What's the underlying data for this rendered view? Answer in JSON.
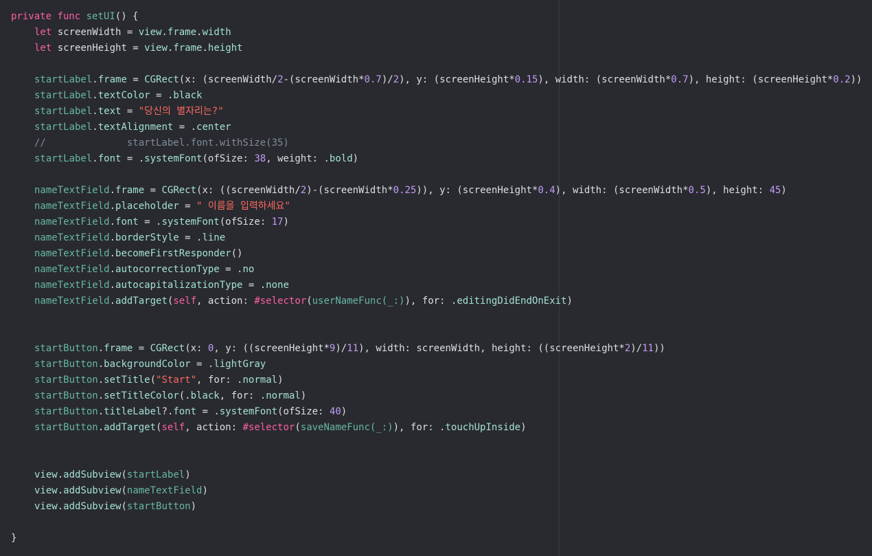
{
  "editor": {
    "theme": {
      "background": "#292a30",
      "guide": "#3a3b41",
      "keyword": "#fc5fa3",
      "project_symbol": "#67b7a4",
      "system_symbol": "#a3e1d4",
      "string": "#fc6a5d",
      "number": "#c29df5",
      "comment": "#7f8c98",
      "plain": "#dfdfe0"
    },
    "lines": [
      [
        {
          "t": "private",
          "c": "kw"
        },
        {
          "t": " "
        },
        {
          "t": "func",
          "c": "kw"
        },
        {
          "t": " "
        },
        {
          "t": "setUI",
          "c": "fn"
        },
        {
          "t": "() {"
        }
      ],
      [
        {
          "t": "",
          "i": 1
        },
        {
          "t": "let",
          "c": "kw"
        },
        {
          "t": " screenWidth = "
        },
        {
          "t": "view",
          "c": "sys"
        },
        {
          "t": "."
        },
        {
          "t": "frame",
          "c": "sys"
        },
        {
          "t": "."
        },
        {
          "t": "width",
          "c": "sys"
        }
      ],
      [
        {
          "t": "",
          "i": 1
        },
        {
          "t": "let",
          "c": "kw"
        },
        {
          "t": " screenHeight = "
        },
        {
          "t": "view",
          "c": "sys"
        },
        {
          "t": "."
        },
        {
          "t": "frame",
          "c": "sys"
        },
        {
          "t": "."
        },
        {
          "t": "height",
          "c": "sys"
        }
      ],
      [],
      [
        {
          "t": "",
          "i": 1
        },
        {
          "t": "startLabel",
          "c": "prj"
        },
        {
          "t": "."
        },
        {
          "t": "frame",
          "c": "sys"
        },
        {
          "t": " = "
        },
        {
          "t": "CGRect",
          "c": "sys"
        },
        {
          "t": "(x: (screenWidth/"
        },
        {
          "t": "2",
          "c": "nump"
        },
        {
          "t": "-(screenWidth*"
        },
        {
          "t": "0.7",
          "c": "nump"
        },
        {
          "t": ")/"
        },
        {
          "t": "2",
          "c": "nump"
        },
        {
          "t": "), y: (screenHeight*"
        },
        {
          "t": "0.15",
          "c": "nump"
        },
        {
          "t": "), width: (screenWidth*"
        },
        {
          "t": "0.7",
          "c": "nump"
        },
        {
          "t": "), height: (screenHeight*"
        },
        {
          "t": "0.2",
          "c": "nump"
        },
        {
          "t": "))"
        }
      ],
      [
        {
          "t": "",
          "i": 1
        },
        {
          "t": "startLabel",
          "c": "prj"
        },
        {
          "t": "."
        },
        {
          "t": "textColor",
          "c": "sys"
        },
        {
          "t": " = ."
        },
        {
          "t": "black",
          "c": "sys"
        }
      ],
      [
        {
          "t": "",
          "i": 1
        },
        {
          "t": "startLabel",
          "c": "prj"
        },
        {
          "t": "."
        },
        {
          "t": "text",
          "c": "sys"
        },
        {
          "t": " = "
        },
        {
          "t": "\"당신의 별자리는?\"",
          "c": "str"
        }
      ],
      [
        {
          "t": "",
          "i": 1
        },
        {
          "t": "startLabel",
          "c": "prj"
        },
        {
          "t": "."
        },
        {
          "t": "textAlignment",
          "c": "sys"
        },
        {
          "t": " = ."
        },
        {
          "t": "center",
          "c": "sys"
        }
      ],
      [
        {
          "t": "",
          "i": 1
        },
        {
          "t": "//",
          "c": "cmt"
        },
        {
          "t": "",
          "i": 2
        },
        {
          "t": "startLabel.font.withSize(35)",
          "c": "cmt"
        }
      ],
      [
        {
          "t": "",
          "i": 1
        },
        {
          "t": "startLabel",
          "c": "prj"
        },
        {
          "t": "."
        },
        {
          "t": "font",
          "c": "sys"
        },
        {
          "t": " = ."
        },
        {
          "t": "systemFont",
          "c": "sys"
        },
        {
          "t": "(ofSize: "
        },
        {
          "t": "38",
          "c": "nump"
        },
        {
          "t": ", weight: ."
        },
        {
          "t": "bold",
          "c": "sys"
        },
        {
          "t": ")"
        }
      ],
      [],
      [
        {
          "t": "",
          "i": 1
        },
        {
          "t": "nameTextField",
          "c": "prj"
        },
        {
          "t": "."
        },
        {
          "t": "frame",
          "c": "sys"
        },
        {
          "t": " = "
        },
        {
          "t": "CGRect",
          "c": "sys"
        },
        {
          "t": "(x: ((screenWidth/"
        },
        {
          "t": "2",
          "c": "nump"
        },
        {
          "t": ")-(screenWidth*"
        },
        {
          "t": "0.25",
          "c": "nump"
        },
        {
          "t": ")), y: (screenHeight*"
        },
        {
          "t": "0.4",
          "c": "nump"
        },
        {
          "t": "), width: (screenWidth*"
        },
        {
          "t": "0.5",
          "c": "nump"
        },
        {
          "t": "), height: "
        },
        {
          "t": "45",
          "c": "nump"
        },
        {
          "t": ")"
        }
      ],
      [
        {
          "t": "",
          "i": 1
        },
        {
          "t": "nameTextField",
          "c": "prj"
        },
        {
          "t": "."
        },
        {
          "t": "placeholder",
          "c": "sys"
        },
        {
          "t": " = "
        },
        {
          "t": "\" 이름을 입력하세요\"",
          "c": "str"
        }
      ],
      [
        {
          "t": "",
          "i": 1
        },
        {
          "t": "nameTextField",
          "c": "prj"
        },
        {
          "t": "."
        },
        {
          "t": "font",
          "c": "sys"
        },
        {
          "t": " = ."
        },
        {
          "t": "systemFont",
          "c": "sys"
        },
        {
          "t": "(ofSize: "
        },
        {
          "t": "17",
          "c": "nump"
        },
        {
          "t": ")"
        }
      ],
      [
        {
          "t": "",
          "i": 1
        },
        {
          "t": "nameTextField",
          "c": "prj"
        },
        {
          "t": "."
        },
        {
          "t": "borderStyle",
          "c": "sys"
        },
        {
          "t": " = ."
        },
        {
          "t": "line",
          "c": "sys"
        }
      ],
      [
        {
          "t": "",
          "i": 1
        },
        {
          "t": "nameTextField",
          "c": "prj"
        },
        {
          "t": "."
        },
        {
          "t": "becomeFirstResponder",
          "c": "sys"
        },
        {
          "t": "()"
        }
      ],
      [
        {
          "t": "",
          "i": 1
        },
        {
          "t": "nameTextField",
          "c": "prj"
        },
        {
          "t": "."
        },
        {
          "t": "autocorrectionType",
          "c": "sys"
        },
        {
          "t": " = ."
        },
        {
          "t": "no",
          "c": "sys"
        }
      ],
      [
        {
          "t": "",
          "i": 1
        },
        {
          "t": "nameTextField",
          "c": "prj"
        },
        {
          "t": "."
        },
        {
          "t": "autocapitalizationType",
          "c": "sys"
        },
        {
          "t": " = ."
        },
        {
          "t": "none",
          "c": "sys"
        }
      ],
      [
        {
          "t": "",
          "i": 1
        },
        {
          "t": "nameTextField",
          "c": "prj"
        },
        {
          "t": "."
        },
        {
          "t": "addTarget",
          "c": "sys"
        },
        {
          "t": "("
        },
        {
          "t": "self",
          "c": "kw"
        },
        {
          "t": ", action: "
        },
        {
          "t": "#selector",
          "c": "kw"
        },
        {
          "t": "("
        },
        {
          "t": "userNameFunc(_:)",
          "c": "prj"
        },
        {
          "t": "), for: ."
        },
        {
          "t": "editingDidEndOnExit",
          "c": "sys"
        },
        {
          "t": ")"
        }
      ],
      [],
      [],
      [
        {
          "t": "",
          "i": 1
        },
        {
          "t": "startButton",
          "c": "prj"
        },
        {
          "t": "."
        },
        {
          "t": "frame",
          "c": "sys"
        },
        {
          "t": " = "
        },
        {
          "t": "CGRect",
          "c": "sys"
        },
        {
          "t": "(x: "
        },
        {
          "t": "0",
          "c": "nump"
        },
        {
          "t": ", y: ((screenHeight*"
        },
        {
          "t": "9",
          "c": "nump"
        },
        {
          "t": ")/"
        },
        {
          "t": "11",
          "c": "nump"
        },
        {
          "t": "), width: screenWidth, height: ((screenHeight*"
        },
        {
          "t": "2",
          "c": "nump"
        },
        {
          "t": ")/"
        },
        {
          "t": "11",
          "c": "nump"
        },
        {
          "t": "))"
        }
      ],
      [
        {
          "t": "",
          "i": 1
        },
        {
          "t": "startButton",
          "c": "prj"
        },
        {
          "t": "."
        },
        {
          "t": "backgroundColor",
          "c": "sys"
        },
        {
          "t": " = ."
        },
        {
          "t": "lightGray",
          "c": "sys"
        }
      ],
      [
        {
          "t": "",
          "i": 1
        },
        {
          "t": "startButton",
          "c": "prj"
        },
        {
          "t": "."
        },
        {
          "t": "setTitle",
          "c": "sys"
        },
        {
          "t": "("
        },
        {
          "t": "\"Start\"",
          "c": "str"
        },
        {
          "t": ", for: ."
        },
        {
          "t": "normal",
          "c": "sys"
        },
        {
          "t": ")"
        }
      ],
      [
        {
          "t": "",
          "i": 1
        },
        {
          "t": "startButton",
          "c": "prj"
        },
        {
          "t": "."
        },
        {
          "t": "setTitleColor",
          "c": "sys"
        },
        {
          "t": "(."
        },
        {
          "t": "black",
          "c": "sys"
        },
        {
          "t": ", for: ."
        },
        {
          "t": "normal",
          "c": "sys"
        },
        {
          "t": ")"
        }
      ],
      [
        {
          "t": "",
          "i": 1
        },
        {
          "t": "startButton",
          "c": "prj"
        },
        {
          "t": "."
        },
        {
          "t": "titleLabel",
          "c": "sys"
        },
        {
          "t": "?."
        },
        {
          "t": "font",
          "c": "sys"
        },
        {
          "t": " = ."
        },
        {
          "t": "systemFont",
          "c": "sys"
        },
        {
          "t": "(ofSize: "
        },
        {
          "t": "40",
          "c": "nump"
        },
        {
          "t": ")"
        }
      ],
      [
        {
          "t": "",
          "i": 1
        },
        {
          "t": "startButton",
          "c": "prj"
        },
        {
          "t": "."
        },
        {
          "t": "addTarget",
          "c": "sys"
        },
        {
          "t": "("
        },
        {
          "t": "self",
          "c": "kw"
        },
        {
          "t": ", action: "
        },
        {
          "t": "#selector",
          "c": "kw"
        },
        {
          "t": "("
        },
        {
          "t": "saveNameFunc(_:)",
          "c": "prj"
        },
        {
          "t": "), for: ."
        },
        {
          "t": "touchUpInside",
          "c": "sys"
        },
        {
          "t": ")"
        }
      ],
      [],
      [],
      [
        {
          "t": "",
          "i": 1
        },
        {
          "t": "view",
          "c": "sys"
        },
        {
          "t": "."
        },
        {
          "t": "addSubview",
          "c": "sys"
        },
        {
          "t": "("
        },
        {
          "t": "startLabel",
          "c": "prj"
        },
        {
          "t": ")"
        }
      ],
      [
        {
          "t": "",
          "i": 1
        },
        {
          "t": "view",
          "c": "sys"
        },
        {
          "t": "."
        },
        {
          "t": "addSubview",
          "c": "sys"
        },
        {
          "t": "("
        },
        {
          "t": "nameTextField",
          "c": "prj"
        },
        {
          "t": ")"
        }
      ],
      [
        {
          "t": "",
          "i": 1
        },
        {
          "t": "view",
          "c": "sys"
        },
        {
          "t": "."
        },
        {
          "t": "addSubview",
          "c": "sys"
        },
        {
          "t": "("
        },
        {
          "t": "startButton",
          "c": "prj"
        },
        {
          "t": ")"
        }
      ],
      [],
      [
        {
          "t": "}"
        }
      ]
    ]
  }
}
